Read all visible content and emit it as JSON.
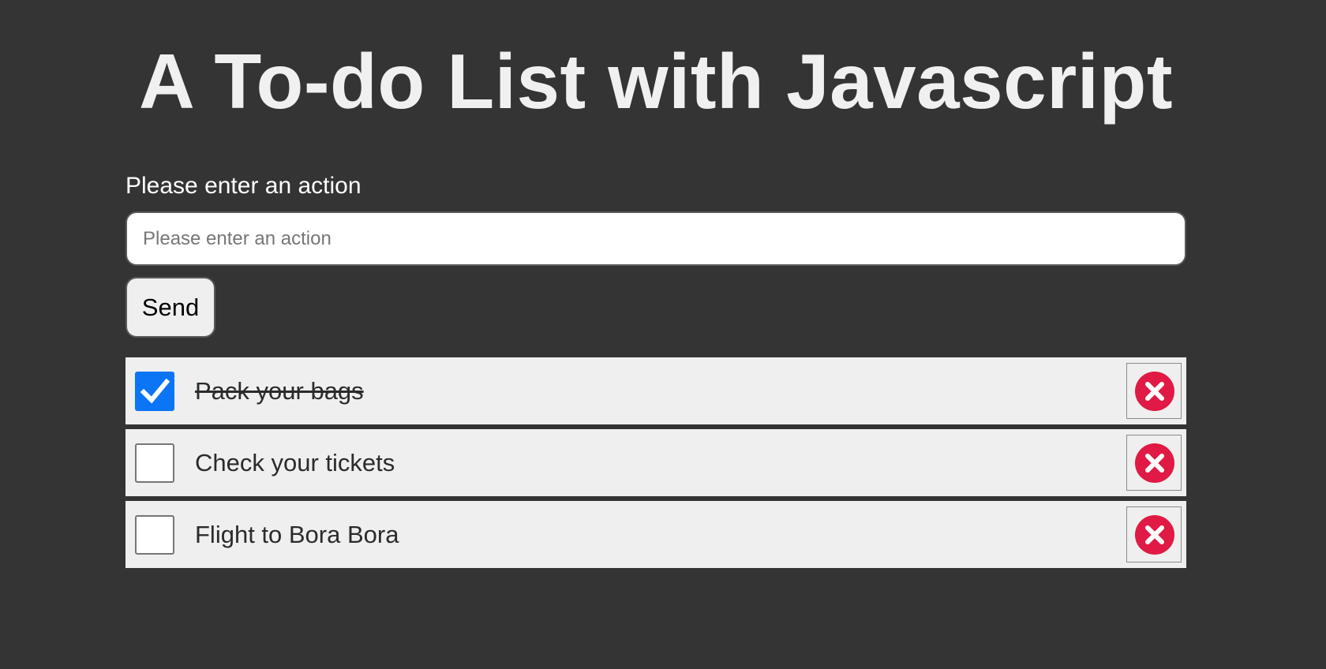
{
  "page": {
    "title": "A To-do List with Javascript"
  },
  "form": {
    "label": "Please enter an action",
    "input_placeholder": "Please enter an action",
    "input_value": "",
    "send_label": "Send"
  },
  "todos": [
    {
      "text": "Pack your bags",
      "done": true
    },
    {
      "text": "Check your tickets",
      "done": false
    },
    {
      "text": "Flight to Bora Bora",
      "done": false
    }
  ],
  "icons": {
    "checkbox_check": "check-icon",
    "delete": "close-circle-icon"
  },
  "colors": {
    "background": "#343434",
    "item_background": "#efefef",
    "checkbox_checked": "#0b75f5",
    "delete_icon": "#e01a44"
  }
}
